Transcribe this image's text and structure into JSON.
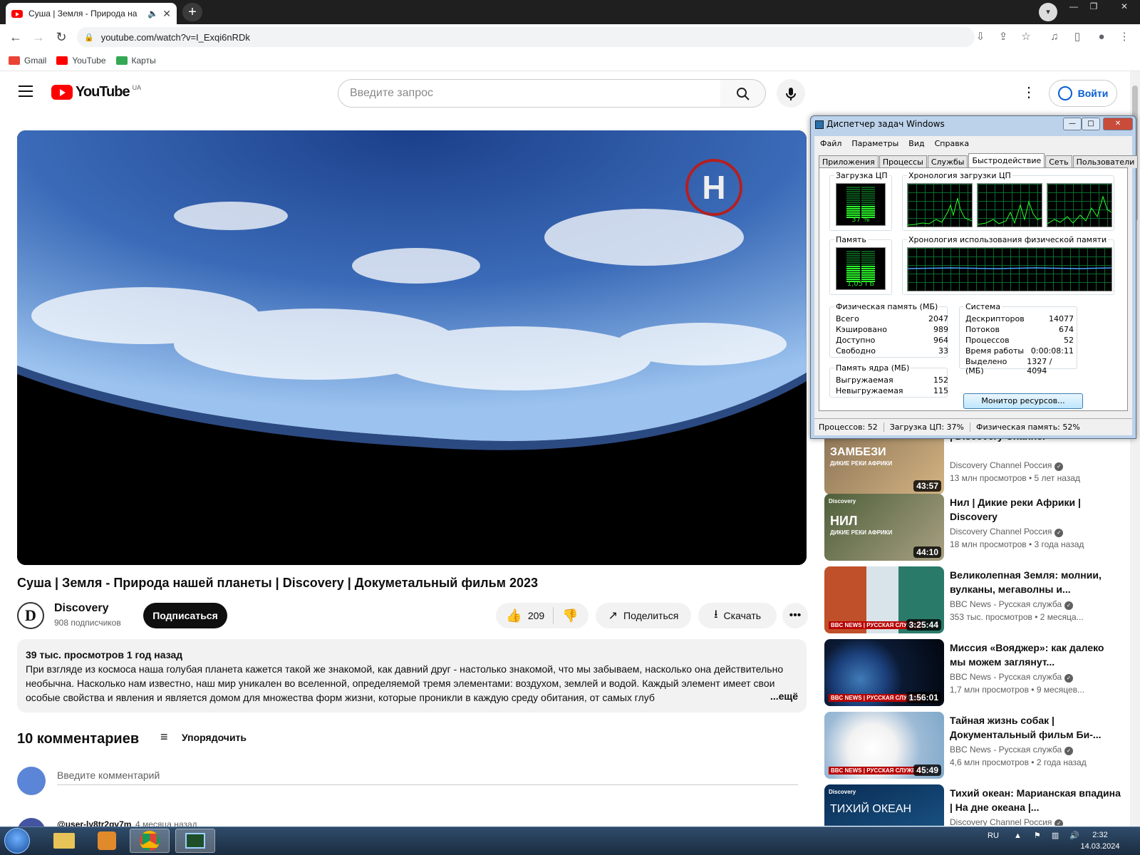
{
  "browser": {
    "tab_title": "Суша | Земля - Природа на",
    "tab_close": "✕",
    "new_tab": "+",
    "url": "youtube.com/watch?v=I_Exqi6nRDk",
    "bookmarks": [
      {
        "label": "Gmail",
        "color": "#ea4335"
      },
      {
        "label": "YouTube",
        "color": "#ff0000"
      },
      {
        "label": "Карты",
        "color": "#34a853"
      }
    ]
  },
  "youtube": {
    "logo_word": "YouTube",
    "country": "UA",
    "search_placeholder": "Введите запрос",
    "signin_label": "Войти"
  },
  "video": {
    "title": "Суша | Земля - Природа нашей планеты | Discovery | Докуметальный фильм 2023",
    "channel_name": "Discovery",
    "channel_logo_letter": "D",
    "subscribers": "908 подписчиков",
    "subscribe_label": "Подписаться",
    "likes": "209",
    "share_label": "Поделиться",
    "download_label": "Скачать",
    "watermark": "H"
  },
  "description": {
    "meta": "39 тыс. просмотров  1 год назад",
    "text": "При взгляде из космоса наша голубая планета кажется такой же знакомой, как давний друг - настолько знакомой, что мы забываем, насколько она действительно необычна. Насколько нам известно, наш мир уникален во вселенной, определяемой тремя элементами: воздухом, землей и водой. Каждый элемент имеет свои особые свойства и явления и является домом для множества форм жизни, которые проникли в каждую среду обитания, от самых глуб",
    "more": "...ещё"
  },
  "comments": {
    "count_label": "10 комментариев",
    "sort_label": "Упорядочить",
    "input_placeholder": "Введите комментарий",
    "first_user": "@user-ly8tr2gv7m",
    "first_time": "4 месяца назад"
  },
  "recommendations": [
    {
      "title": "| Discovery Channel",
      "channel": "Discovery Channel Россия",
      "views": "13 млн просмотров",
      "age": "5 лет назад",
      "duration": "43:57",
      "thumb_text": "ЗАМБЕЗИ",
      "thumb_sub": "ДИКИЕ РЕКИ АФРИКИ",
      "color1": "#8b7355",
      "color2": "#d4b483"
    },
    {
      "title": "Нил | Дикие реки Африки | Discovery",
      "channel": "Discovery Channel Россия",
      "views": "18 млн просмотров",
      "age": "3 года назад",
      "duration": "44:10",
      "thumb_text": "НИЛ",
      "thumb_sub": "ДИКИЕ РЕКИ АФРИКИ",
      "brand": "Discovery",
      "color1": "#4e5f3a",
      "color2": "#a9a182"
    },
    {
      "title": "Великолепная Земля: молнии, вулканы, мегаволны и...",
      "channel": "BBC News - Русская служба",
      "views": "353 тыс. просмотров",
      "age": "2 месяца...",
      "duration": "3:25:44",
      "bbc": "BBC NEWS | РУССКАЯ СЛУЖБА",
      "color1": "#c0502a",
      "color2": "#5aa6a0"
    },
    {
      "title": "Миссия «Вояджер»: как далеко мы можем заглянут...",
      "channel": "BBC News - Русская служба",
      "views": "1,7 млн просмотров",
      "age": "9 месяцев...",
      "duration": "1:56:01",
      "bbc": "BBC NEWS | РУССКАЯ СЛУЖБА",
      "color1": "#0b1a33",
      "color2": "#3f7bb8"
    },
    {
      "title": "Тайная жизнь собак | Документальный фильм Би-...",
      "channel": "BBC News - Русская служба",
      "views": "4,6 млн просмотров",
      "age": "2 года назад",
      "duration": "45:49",
      "bbc": "BBC NEWS | РУССКАЯ СЛУЖБА",
      "color1": "#7fa8c9",
      "color2": "#f2f2f2"
    },
    {
      "title": "Тихий океан: Марианская впадина | На дне океана |...",
      "channel": "Discovery Channel Россия",
      "views": "",
      "age": "",
      "duration": "",
      "thumb_text": "ТИХИЙ ОКЕАН",
      "brand": "Discovery",
      "color1": "#0a2d55",
      "color2": "#1c5a8c"
    }
  ],
  "task_manager": {
    "title": "Диспетчер задач Windows",
    "menu": [
      "Файл",
      "Параметры",
      "Вид",
      "Справка"
    ],
    "tabs": [
      "Приложения",
      "Процессы",
      "Службы",
      "Быстродействие",
      "Сеть",
      "Пользователи"
    ],
    "active_tab": "Быстродействие",
    "cpu_label": "Загрузка ЦП",
    "cpu_value": "37 %",
    "cpu_history_label": "Хронология загрузки ЦП",
    "mem_label": "Память",
    "mem_value": "1,05 ГБ",
    "mem_history_label": "Хронология использования физической памяти",
    "phys_title": "Физическая память (МБ)",
    "phys_rows": [
      {
        "k": "Всего",
        "v": "2047"
      },
      {
        "k": "Кэшировано",
        "v": "989"
      },
      {
        "k": "Доступно",
        "v": "964"
      },
      {
        "k": "Свободно",
        "v": "33"
      }
    ],
    "kernel_title": "Память ядра (МБ)",
    "kernel_rows": [
      {
        "k": "Выгружаемая",
        "v": "152"
      },
      {
        "k": "Невыгружаемая",
        "v": "115"
      }
    ],
    "system_title": "Система",
    "system_rows": [
      {
        "k": "Дескрипторов",
        "v": "14077"
      },
      {
        "k": "Потоков",
        "v": "674"
      },
      {
        "k": "Процессов",
        "v": "52"
      },
      {
        "k": "Время работы",
        "v": "0:00:08:11"
      },
      {
        "k": "Выделено (МБ)",
        "v": "1327 / 4094"
      }
    ],
    "resource_button": "Монитор ресурсов...",
    "status": [
      "Процессов: 52",
      "Загрузка ЦП: 37%",
      "Физическая память: 52%"
    ],
    "cpu_percent": 37,
    "mem_percent": 52
  },
  "taskbar": {
    "lang": "RU",
    "time": "2:32",
    "date": "14.03.2024"
  }
}
